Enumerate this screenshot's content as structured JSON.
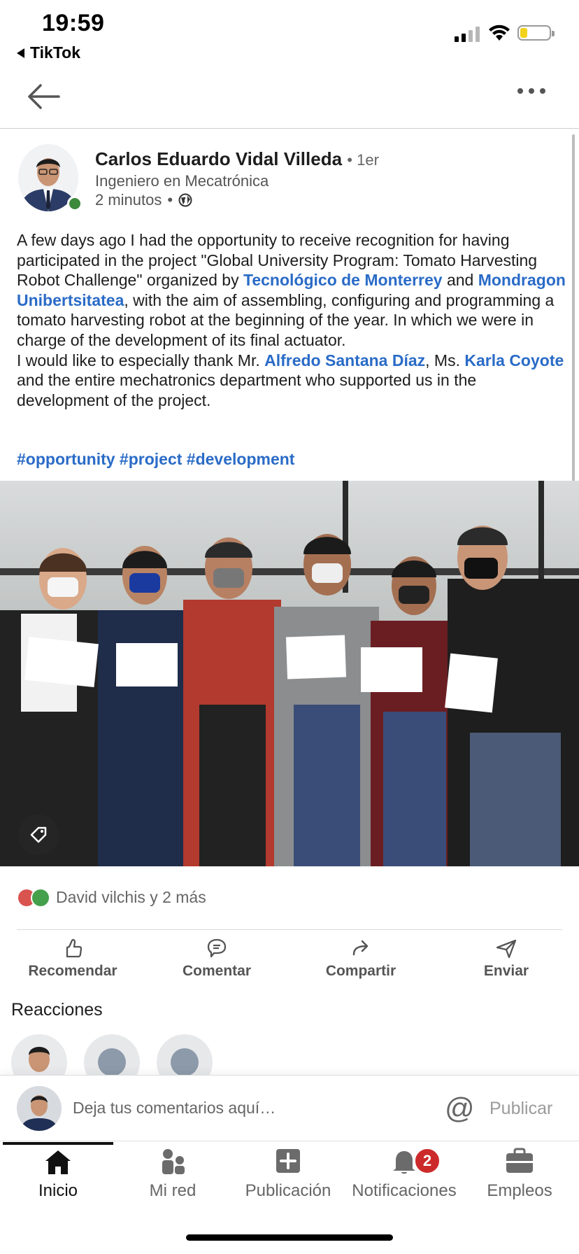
{
  "status_bar": {
    "time": "19:59",
    "back_app": "TikTok"
  },
  "post": {
    "author": {
      "name": "Carlos Eduardo Vidal Villeda",
      "degree": "1er",
      "headline": "Ingeniero en Mecatrónica",
      "time": "2 minutos",
      "visibility_icon": "globe-icon"
    },
    "text": {
      "p1_a": "A few days ago I had the opportunity to receive recognition for having participated in the project \"Global University Program: Tomato Harvesting Robot Challenge\" organized by ",
      "p1_link1": "Tecnológico de Monterrey",
      "p1_b": " and ",
      "p1_link2": "Mondragon Unibertsitatea",
      "p1_c": ", with the aim of assembling, configuring and programming a tomato harvesting robot at the beginning of the year. In which we were in charge of the development of its final actuator.",
      "p2_a": "I would like to especially thank Mr. ",
      "p2_link1": "Alfredo Santana Díaz",
      "p2_b": ", Ms. ",
      "p2_link2": "Karla Coyote",
      "p2_c": " and the entire mechatronics department who supported us in the development of the project.",
      "hashtags": "#opportunity #project #development"
    },
    "reactions_summary": "David vilchis y 2 más",
    "actions": [
      {
        "label": "Recomendar",
        "icon": "thumbs-up-icon"
      },
      {
        "label": "Comentar",
        "icon": "comment-icon"
      },
      {
        "label": "Compartir",
        "icon": "share-arrow-icon"
      },
      {
        "label": "Enviar",
        "icon": "send-icon"
      }
    ],
    "reactions_title": "Reacciones"
  },
  "comment_bar": {
    "placeholder": "Deja tus comentarios aquí…",
    "at_symbol": "@",
    "publish_label": "Publicar"
  },
  "tabs": [
    {
      "label": "Inicio",
      "icon": "home-icon",
      "active": true
    },
    {
      "label": "Mi red",
      "icon": "network-icon"
    },
    {
      "label": "Publicación",
      "icon": "plus-square-icon"
    },
    {
      "label": "Notificaciones",
      "icon": "bell-icon",
      "badge": "2"
    },
    {
      "label": "Empleos",
      "icon": "briefcase-icon"
    }
  ],
  "colors": {
    "link": "#2a6bc7",
    "badge": "#cc2a2a",
    "online": "#3c8a3c"
  }
}
